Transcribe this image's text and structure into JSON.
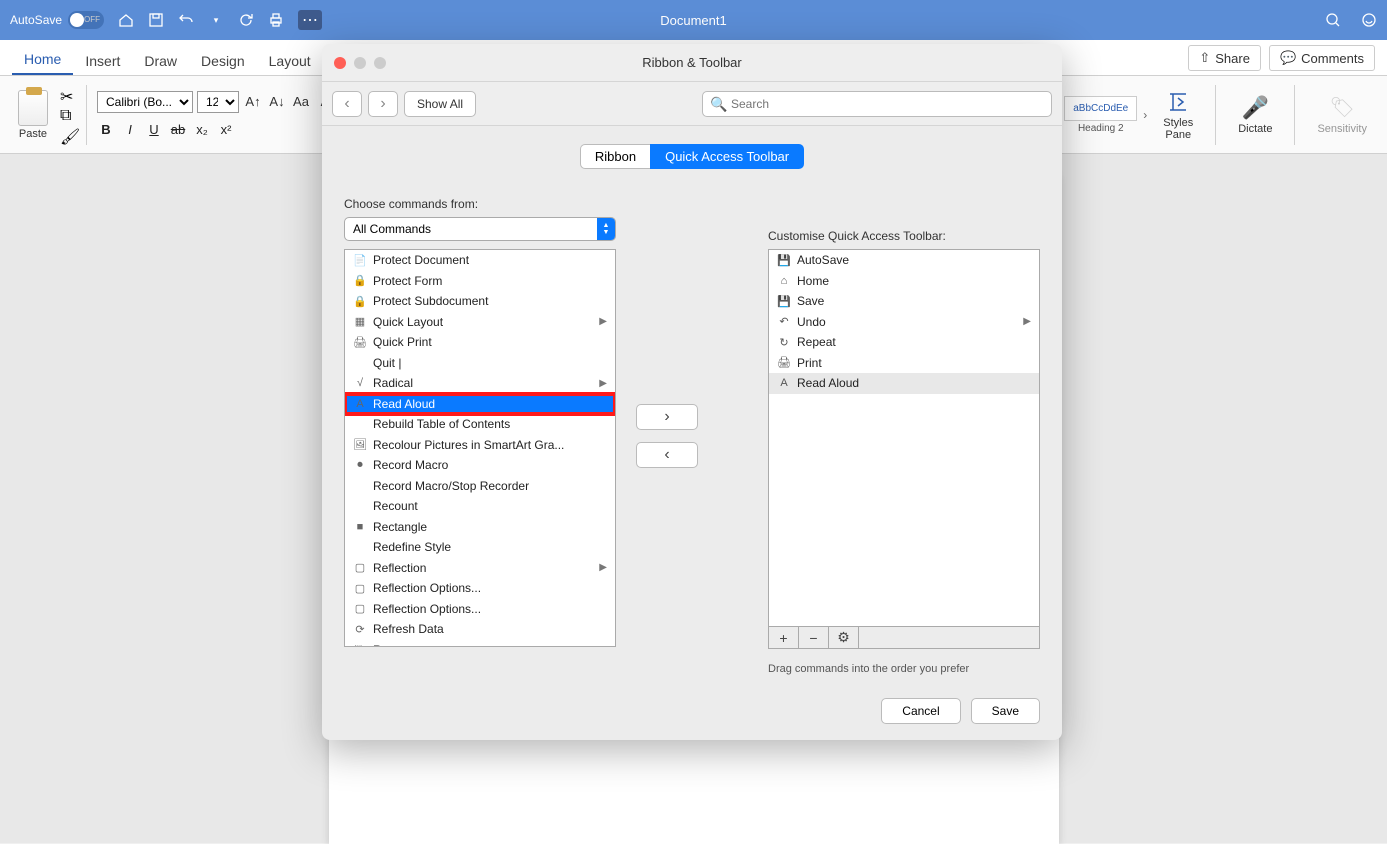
{
  "titlebar": {
    "autosave": "AutoSave",
    "autosave_state": "OFF",
    "document_title": "Document1"
  },
  "ribbon_tabs": {
    "home": "Home",
    "insert": "Insert",
    "draw": "Draw",
    "design": "Design",
    "layout": "Layout"
  },
  "ribbon_right": {
    "share": "Share",
    "comments": "Comments"
  },
  "ribbon": {
    "paste": "Paste",
    "font_name": "Calibri (Bo...",
    "font_size": "12",
    "style_sample": "aBbCcDdEe",
    "style_name": "Heading 2",
    "styles_pane": "Styles\nPane",
    "dictate": "Dictate",
    "sensitivity": "Sensitivity"
  },
  "dialog": {
    "title": "Ribbon & Toolbar",
    "show_all": "Show All",
    "search_placeholder": "Search",
    "seg_ribbon": "Ribbon",
    "seg_qat": "Quick Access Toolbar",
    "choose_label": "Choose commands from:",
    "choose_value": "All Commands",
    "customise_label": "Customise Quick Access Toolbar:",
    "drag_hint": "Drag commands into the order you prefer",
    "cancel": "Cancel",
    "save": "Save",
    "commands": [
      {
        "label": "Protect Document",
        "icon": "📄"
      },
      {
        "label": "Protect Form",
        "icon": "🔒"
      },
      {
        "label": "Protect Subdocument",
        "icon": "🔒"
      },
      {
        "label": "Quick Layout",
        "icon": "▦",
        "sub": true
      },
      {
        "label": "Quick Print",
        "icon": "🖨"
      },
      {
        "label": "Quit |",
        "icon": ""
      },
      {
        "label": "Radical",
        "icon": "√",
        "sub": true
      },
      {
        "label": "Read Aloud",
        "icon": "A",
        "selected": true,
        "highlight": true
      },
      {
        "label": "Rebuild Table of Contents",
        "icon": ""
      },
      {
        "label": "Recolour Pictures in SmartArt Gra...",
        "icon": "🖼"
      },
      {
        "label": "Record Macro",
        "icon": "⏺"
      },
      {
        "label": "Record Macro/Stop Recorder",
        "icon": ""
      },
      {
        "label": "Recount",
        "icon": ""
      },
      {
        "label": "Rectangle",
        "icon": "■"
      },
      {
        "label": "Redefine Style",
        "icon": ""
      },
      {
        "label": "Reflection",
        "icon": "▢",
        "sub": true
      },
      {
        "label": "Reflection Options...",
        "icon": "▢"
      },
      {
        "label": "Reflection Options...",
        "icon": "▢"
      },
      {
        "label": "Refresh Data",
        "icon": "⟳"
      },
      {
        "label": "Regroup",
        "icon": "⿻"
      }
    ],
    "qat_items": [
      {
        "label": "AutoSave",
        "icon": "💾",
        "color": "#c837c8"
      },
      {
        "label": "Home",
        "icon": "⌂",
        "color": "#555"
      },
      {
        "label": "Save",
        "icon": "💾",
        "color": "#c837c8"
      },
      {
        "label": "Undo",
        "icon": "↶",
        "color": "#555",
        "sub": true
      },
      {
        "label": "Repeat",
        "icon": "↻",
        "color": "#555"
      },
      {
        "label": "Print",
        "icon": "🖨",
        "color": "#555"
      },
      {
        "label": "Read Aloud",
        "icon": "A",
        "color": "#555",
        "selected": true
      }
    ]
  }
}
